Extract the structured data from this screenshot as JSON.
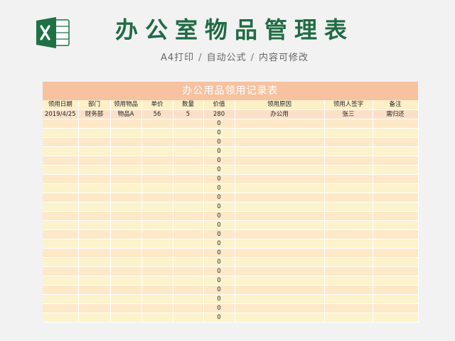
{
  "header": {
    "title": "办公室物品管理表",
    "subtitle_parts": [
      "A4打印",
      "自动公式",
      "内容可修改"
    ],
    "separator": "/"
  },
  "sheet": {
    "title": "办公用品领用记录表",
    "columns": [
      "领用日期",
      "部门",
      "领用物品",
      "单价",
      "数量",
      "价值",
      "领用原因",
      "领用人签字",
      "备注"
    ],
    "rows": [
      [
        "2019/4/25",
        "财务部",
        "物品A",
        "56",
        "5",
        "280",
        "办公用",
        "张三",
        "需归还"
      ],
      [
        "",
        "",
        "",
        "",
        "",
        "0",
        "",
        "",
        ""
      ],
      [
        "",
        "",
        "",
        "",
        "",
        "0",
        "",
        "",
        ""
      ],
      [
        "",
        "",
        "",
        "",
        "",
        "0",
        "",
        "",
        ""
      ],
      [
        "",
        "",
        "",
        "",
        "",
        "0",
        "",
        "",
        ""
      ],
      [
        "",
        "",
        "",
        "",
        "",
        "0",
        "",
        "",
        ""
      ],
      [
        "",
        "",
        "",
        "",
        "",
        "0",
        "",
        "",
        ""
      ],
      [
        "",
        "",
        "",
        "",
        "",
        "0",
        "",
        "",
        ""
      ],
      [
        "",
        "",
        "",
        "",
        "",
        "0",
        "",
        "",
        ""
      ],
      [
        "",
        "",
        "",
        "",
        "",
        "0",
        "",
        "",
        ""
      ],
      [
        "",
        "",
        "",
        "",
        "",
        "0",
        "",
        "",
        ""
      ],
      [
        "",
        "",
        "",
        "",
        "",
        "0",
        "",
        "",
        ""
      ],
      [
        "",
        "",
        "",
        "",
        "",
        "0",
        "",
        "",
        ""
      ],
      [
        "",
        "",
        "",
        "",
        "",
        "0",
        "",
        "",
        ""
      ],
      [
        "",
        "",
        "",
        "",
        "",
        "0",
        "",
        "",
        ""
      ],
      [
        "",
        "",
        "",
        "",
        "",
        "0",
        "",
        "",
        ""
      ],
      [
        "",
        "",
        "",
        "",
        "",
        "0",
        "",
        "",
        ""
      ],
      [
        "",
        "",
        "",
        "",
        "",
        "0",
        "",
        "",
        ""
      ],
      [
        "",
        "",
        "",
        "",
        "",
        "0",
        "",
        "",
        ""
      ],
      [
        "",
        "",
        "",
        "",
        "",
        "0",
        "",
        "",
        ""
      ],
      [
        "",
        "",
        "",
        "",
        "",
        "0",
        "",
        "",
        ""
      ],
      [
        "",
        "",
        "",
        "",
        "",
        "0",
        "",
        "",
        ""
      ],
      [
        "",
        "",
        "",
        "",
        "",
        "0",
        "",
        "",
        ""
      ]
    ]
  },
  "colors": {
    "title_green": "#1f6b44",
    "sheet_header": "#f7c2a0",
    "row_a": "#fde8c8",
    "row_b": "#fcf3cc"
  },
  "icons": {
    "logo": "excel-logo-icon"
  }
}
